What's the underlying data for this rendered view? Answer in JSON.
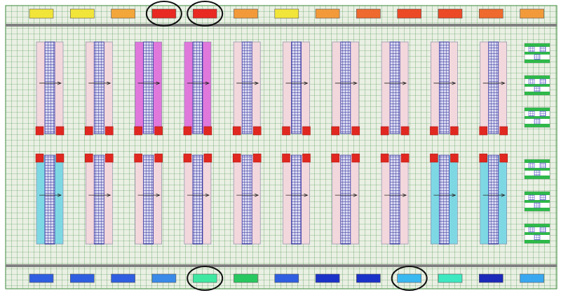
{
  "top_row": {
    "swatches": [
      {
        "color": "#f2e53a",
        "circled": false
      },
      {
        "color": "#f2e53a",
        "circled": false
      },
      {
        "color": "#f3a63a",
        "circled": false
      },
      {
        "color": "#e82a22",
        "circled": true
      },
      {
        "color": "#e82a22",
        "circled": true
      },
      {
        "color": "#f29a3a",
        "circled": false
      },
      {
        "color": "#f2e53a",
        "circled": false
      },
      {
        "color": "#f29a3a",
        "circled": false
      },
      {
        "color": "#ee6a2e",
        "circled": false
      },
      {
        "color": "#ec4a26",
        "circled": false
      },
      {
        "color": "#ec4a26",
        "circled": false
      },
      {
        "color": "#ee6a2e",
        "circled": false
      },
      {
        "color": "#f29a3a",
        "circled": false
      }
    ]
  },
  "bottom_row": {
    "swatches": [
      {
        "color": "#2f5fe0",
        "circled": false
      },
      {
        "color": "#2f5fe0",
        "circled": false
      },
      {
        "color": "#2f5fe0",
        "circled": false
      },
      {
        "color": "#3a8ae8",
        "circled": false
      },
      {
        "color": "#3ee8a0",
        "circled": true
      },
      {
        "color": "#28c860",
        "circled": false
      },
      {
        "color": "#2f5fe0",
        "circled": false
      },
      {
        "color": "#1b32c8",
        "circled": false
      },
      {
        "color": "#1b32c8",
        "circled": false
      },
      {
        "color": "#3ab8f0",
        "circled": true
      },
      {
        "color": "#3ee8c0",
        "circled": false
      },
      {
        "color": "#1b2ab8",
        "circled": false
      },
      {
        "color": "#3aa8f0",
        "circled": false
      }
    ]
  },
  "upper_columns": [
    {
      "fill": "#f2d8dc"
    },
    {
      "fill": "#f2d8dc"
    },
    {
      "fill": "#e078dc"
    },
    {
      "fill": "#e078dc"
    },
    {
      "fill": "#f2d8dc"
    },
    {
      "fill": "#f2d8dc"
    },
    {
      "fill": "#f2d8dc"
    },
    {
      "fill": "#f2d8dc"
    },
    {
      "fill": "#f2d8dc"
    },
    {
      "fill": "#f2d8dc"
    }
  ],
  "lower_columns": [
    {
      "fill": "#7ed8e4"
    },
    {
      "fill": "#f2d8dc"
    },
    {
      "fill": "#f2d8dc"
    },
    {
      "fill": "#f2d8dc"
    },
    {
      "fill": "#f2d8dc"
    },
    {
      "fill": "#f2d8dc"
    },
    {
      "fill": "#f2d8dc"
    },
    {
      "fill": "#f2d8dc"
    },
    {
      "fill": "#7ed8e4"
    },
    {
      "fill": "#7ed8e4"
    }
  ],
  "side_modules": {
    "upper_count": 3,
    "lower_count": 3,
    "band_color": "#2fb84a",
    "tile_color": "#5050c8"
  },
  "colors": {
    "grid_line": "#3a8a3a",
    "grid_bg": "#eaf0e4",
    "rail": "#808080",
    "pad": "#e02820",
    "column_core": "#3030a0",
    "circle": "#111111"
  }
}
